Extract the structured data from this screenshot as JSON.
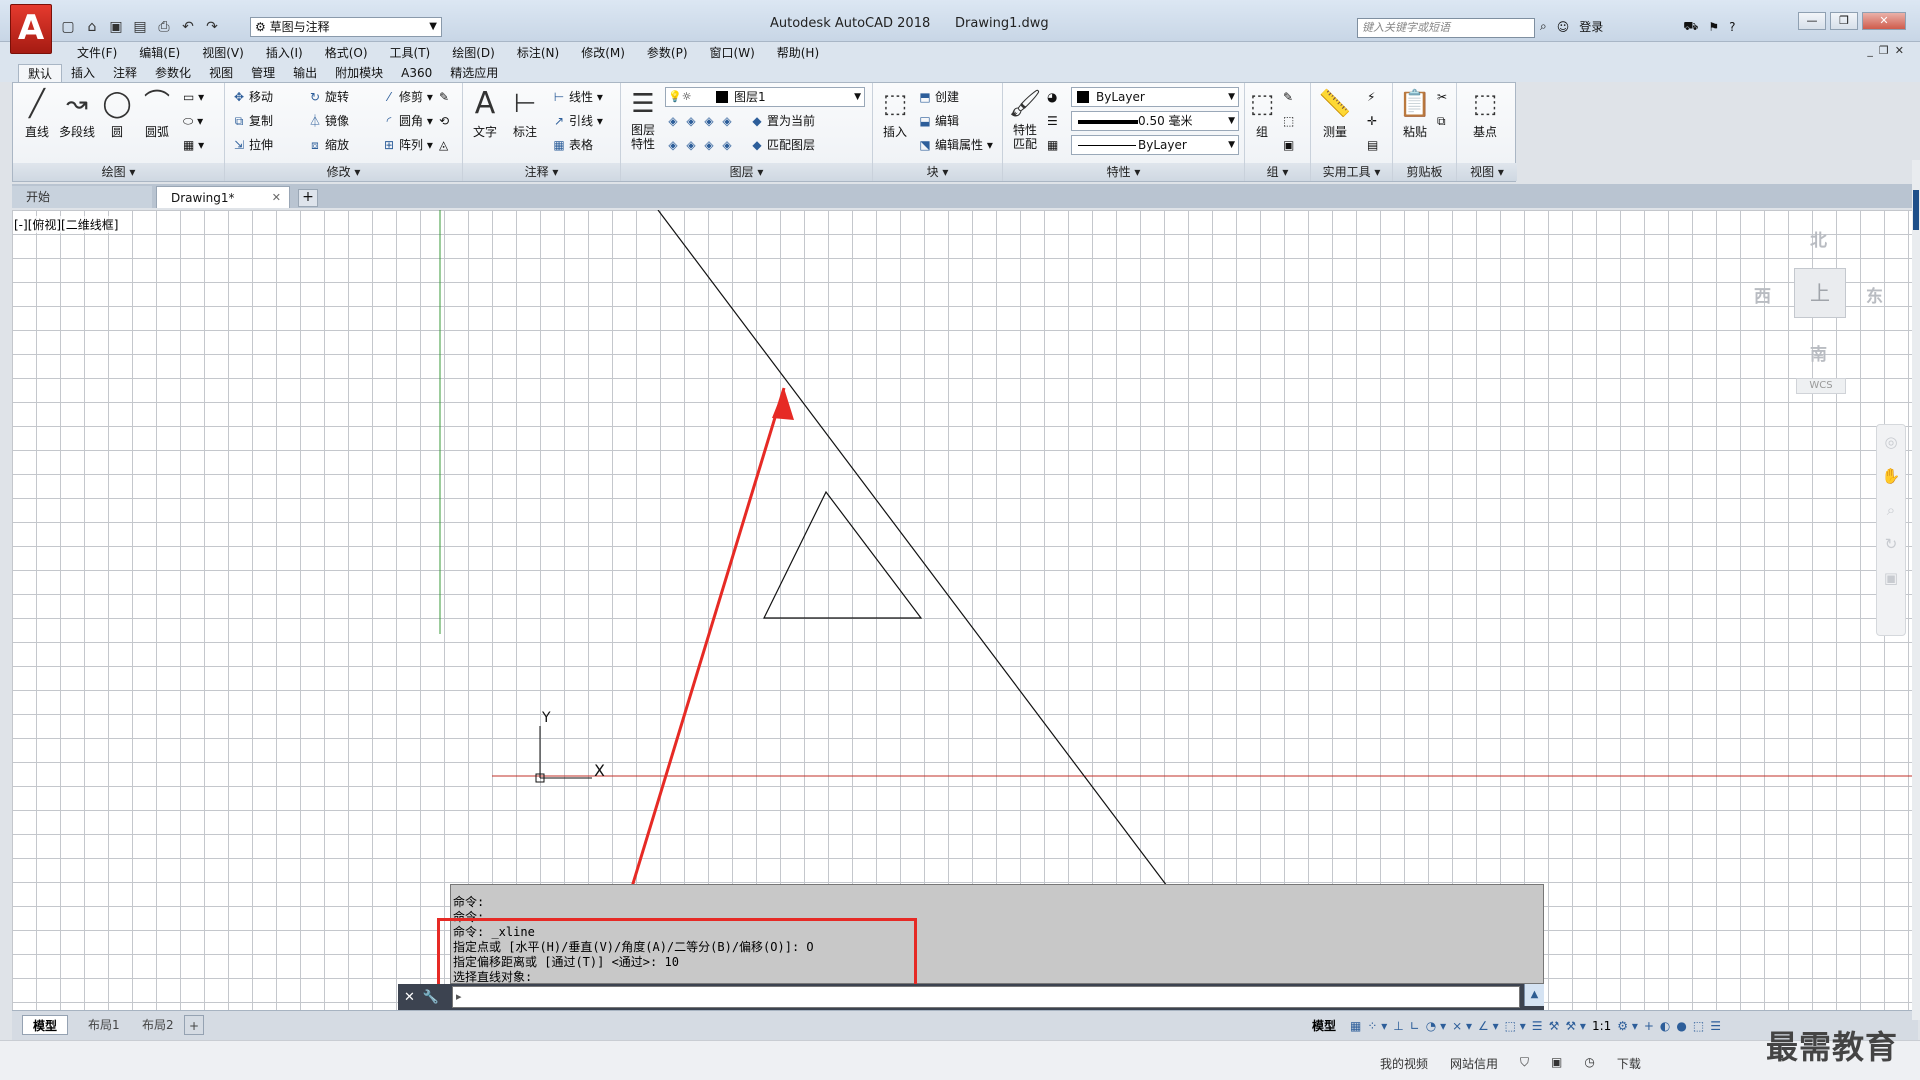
{
  "app": {
    "logo_letter": "A",
    "title": "Autodesk AutoCAD 2018",
    "document": "Drawing1.dwg",
    "workspace": "草图与注释",
    "search_placeholder": "键入关键字或短语",
    "login": "登录"
  },
  "menubar": [
    "文件(F)",
    "编辑(E)",
    "视图(V)",
    "插入(I)",
    "格式(O)",
    "工具(T)",
    "绘图(D)",
    "标注(N)",
    "修改(M)",
    "参数(P)",
    "窗口(W)",
    "帮助(H)"
  ],
  "ribbon_tabs": [
    "默认",
    "插入",
    "注释",
    "参数化",
    "视图",
    "管理",
    "输出",
    "附加模块",
    "A360",
    "精选应用"
  ],
  "ribbon": {
    "draw": {
      "title": "绘图",
      "line": "直线",
      "polyline": "多段线",
      "circle": "圆",
      "arc": "圆弧"
    },
    "modify": {
      "title": "修改",
      "move": "移动",
      "rotate": "旋转",
      "trim": "修剪",
      "copy": "复制",
      "mirror": "镜像",
      "fillet": "圆角",
      "stretch": "拉伸",
      "scale": "缩放",
      "array": "阵列"
    },
    "annotation": {
      "title": "注释",
      "text": "文字",
      "dimension": "标注",
      "linear": "线性",
      "leader": "引线",
      "table": "表格"
    },
    "layers": {
      "title": "图层",
      "layer_props": "图层\n特性",
      "current_layer": "图层1",
      "make_current": "置为当前",
      "match_layer": "匹配图层"
    },
    "block": {
      "title": "块",
      "insert": "插入",
      "create": "创建",
      "edit": "编辑",
      "edit_attr": "编辑属性"
    },
    "properties": {
      "title": "特性",
      "match": "特性\n匹配",
      "color": "ByLayer",
      "lineweight": "0.50 毫米",
      "linetype": "ByLayer"
    },
    "groups": {
      "title": "组",
      "group": "组"
    },
    "utilities": {
      "title": "实用工具",
      "measure": "测量"
    },
    "clipboard": {
      "title": "剪贴板",
      "paste": "粘贴"
    },
    "view": {
      "title": "视图",
      "base": "基点"
    }
  },
  "file_tabs": {
    "start": "开始",
    "doc": "Drawing1*"
  },
  "viewport_label": "[-][俯视][二维线框]",
  "viewcube": {
    "north": "北",
    "south": "南",
    "east": "东",
    "west": "西",
    "face": "上",
    "wcs": "WCS"
  },
  "ucs": {
    "x": "X",
    "y": "Y"
  },
  "command_history": [
    "命令:",
    "命令:",
    "命令: _xline",
    "指定点或 [水平(H)/垂直(V)/角度(A)/二等分(B)/偏移(O)]: O",
    "指定偏移距离或 [通过(T)] <通过>: 10",
    "选择直线对象:"
  ],
  "command_input": "",
  "layout_tabs": [
    "模型",
    "布局1",
    "布局2"
  ],
  "status": {
    "model": "模型",
    "scale": "1:1"
  },
  "os_bar": [
    "我的视频",
    "网站信用",
    "下载"
  ],
  "watermark": "最需教育",
  "colors": {
    "accent_red": "#e62a25",
    "grid": "#c4c7cc",
    "x_axis": "#c0302a",
    "y_axis": "#3a9a3a"
  }
}
